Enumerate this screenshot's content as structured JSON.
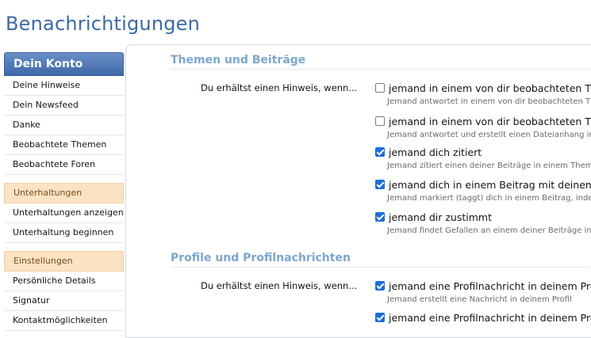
{
  "page": {
    "title": "Benachrichtigungen"
  },
  "sidebar": {
    "head": "Dein Konto",
    "group1": [
      "Deine Hinweise",
      "Dein Newsfeed",
      "Danke",
      "Beobachtete Themen",
      "Beobachtete Foren"
    ],
    "sec2": "Unterhaltungen",
    "group2": [
      "Unterhaltungen anzeigen",
      "Unterhaltung beginnen"
    ],
    "sec3": "Einstellungen",
    "group3": [
      "Persönliche Details",
      "Signatur",
      "Kontaktmöglichkeiten"
    ]
  },
  "sections": [
    {
      "title": "Themen und Beiträge",
      "row_label": "Du erhältst einen Hinweis, wenn...",
      "options": [
        {
          "label": "jemand in einem von dir beobachteten Them",
          "hint": "Jemand antwortet in einem von dir beobachteten Th",
          "checked": false
        },
        {
          "label": "jemand in einem von dir beobachteten Ther",
          "hint": "Jemand antwortet und erstellt einen Dateianhang in",
          "checked": false
        },
        {
          "label": "jemand dich zitiert",
          "hint": "Jemand zitiert einen deiner Beiträge in einem Thema",
          "checked": true
        },
        {
          "label": "jemand dich in einem Beitrag mit deinem B",
          "hint": "Jemand markiert (taggt) dich in einem Beitrag, inde",
          "checked": true
        },
        {
          "label": "jemand dir zustimmt",
          "hint": "Jemand findet Gefallen an einem deiner Beiträge in e",
          "checked": true
        }
      ]
    },
    {
      "title": "Profile und Profilnachrichten",
      "row_label": "Du erhältst einen Hinweis, wenn...",
      "options": [
        {
          "label": "jemand eine Profilnachricht in deinem Profil",
          "hint": "Jemand erstellt eine Nachricht in deinem Profil",
          "checked": true
        },
        {
          "label": "jemand eine Profilnachricht in deinem Prof",
          "hint": "",
          "checked": true
        }
      ]
    }
  ]
}
